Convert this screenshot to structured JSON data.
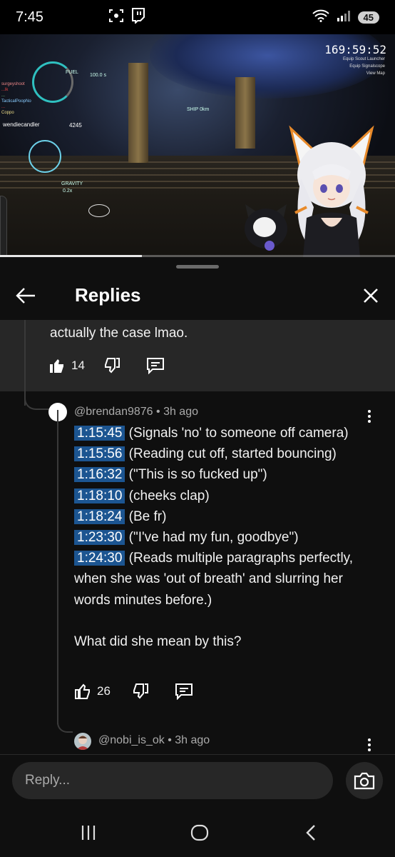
{
  "status_bar": {
    "time": "7:45",
    "battery": "45",
    "icons": [
      "screenshot-icon",
      "twitch-icon",
      "wifi-icon",
      "signal-icon",
      "battery-icon"
    ]
  },
  "video": {
    "hud_timer": "169:59:52",
    "hud_menu": [
      "Equip Scout Launcher",
      "Equip Signalscope",
      "View Map"
    ],
    "hud_fuel": "FUEL",
    "hud_speed": "100.0 s",
    "hud_shop": "SHIP 0km",
    "gravity_label": "GRAVITY",
    "gravity_value": "0.2x",
    "killfeed": [
      "surgeyshoot",
      "...lk",
      "...",
      "TacticalPoopNo",
      "...",
      "Coppo"
    ],
    "player_name": "wendiecandler",
    "score": "4245",
    "progress_fraction": 0.36
  },
  "sheet": {
    "title": "Replies"
  },
  "parent_comment": {
    "text_tail": "actually the case lmao.",
    "likes": "14"
  },
  "reply": {
    "author": "@brendan9876",
    "age": "3h ago",
    "lines": [
      {
        "ts": "1:15:45",
        "text": " (Signals 'no' to someone off camera)"
      },
      {
        "ts": "1:15:56",
        "text": " (Reading cut off, started bouncing)"
      },
      {
        "ts": "1:16:32",
        "text": " (\"This is so fucked up\")"
      },
      {
        "ts": "1:18:10",
        "text": " (cheeks clap)"
      },
      {
        "ts": "1:18:24",
        "text": " (Be fr)"
      },
      {
        "ts": "1:23:30",
        "text": " (\"I've had my fun, goodbye\")"
      },
      {
        "ts": "1:24:30",
        "text": " (Reads multiple paragraphs perfectly, when she was 'out of breath' and slurring her words minutes before.)"
      }
    ],
    "closing": "What did she mean by this?",
    "likes": "26"
  },
  "next_reply": {
    "author": "@nobi_is_ok",
    "age": "3h ago"
  },
  "reply_bar": {
    "placeholder": "Reply..."
  },
  "colors": {
    "background": "#0f0f0f",
    "parent_bg": "#272727",
    "timestamp_bg": "#1c5591",
    "meta_text": "#aaaaaa"
  }
}
